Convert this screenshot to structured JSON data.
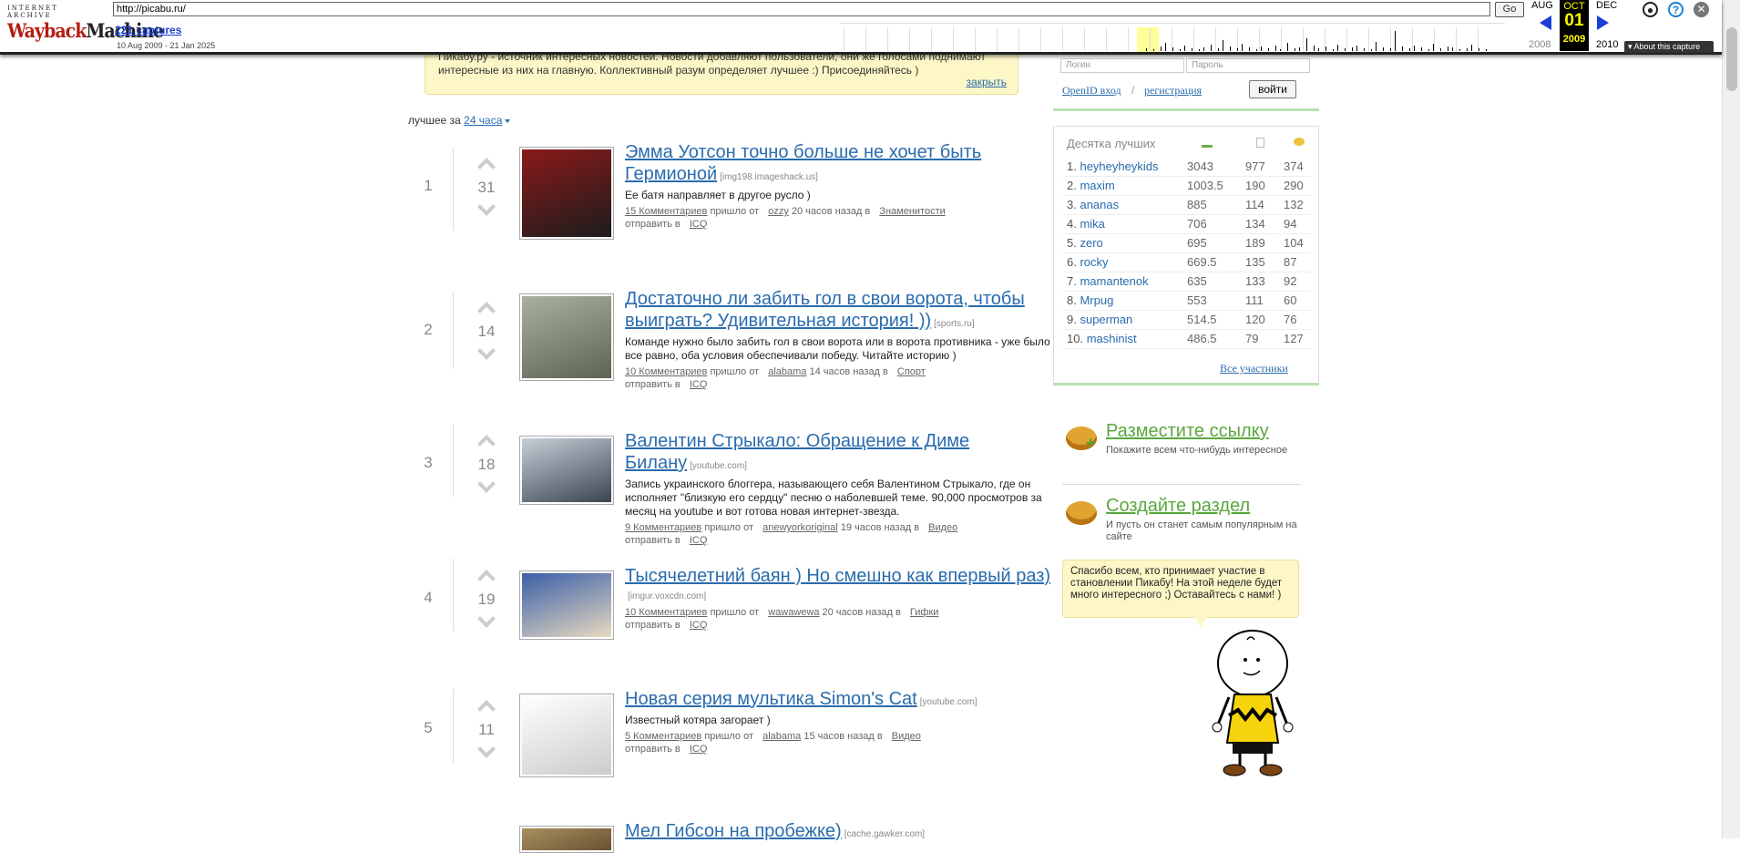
{
  "wayback": {
    "logo_small": "INTERNET ARCHIVE",
    "logo_main_a": "Wayback",
    "logo_main_b": "Machine",
    "url": "http://picabu.ru/",
    "go": "Go",
    "captures": "221 captures",
    "range": "10 Aug 2009 - 21 Jan 2025",
    "prev_month": "AUG",
    "cur_month": "OCT",
    "cur_day": "01",
    "cur_year": "2009",
    "next_month": "DEC",
    "prev_year": "2008",
    "next_year": "2010",
    "about": "About this capture",
    "accent": "#1a3fd6"
  },
  "notice": {
    "text": "Пикабу.ру - источник интересных новостей. Новости добавляют пользователи, они же голосами поднимают интересные из них на главную. Коллективный разум определяет лучшее :) Присоединяйтесь )",
    "close": "закрыть"
  },
  "best": {
    "prefix": "лучшее за",
    "period": "24 часа"
  },
  "posts": [
    {
      "rank": "1",
      "score": "31",
      "title": "Эмма Уотсон точно больше не хочет быть Гермионой",
      "source": "[img198.imageshack.us]",
      "desc": "Ее батя направляет в другое русло )",
      "comments": "15 Комментариев",
      "came_from": "пришло от",
      "user": "ozzy",
      "time": "20 часов назад в",
      "category": "Знаменитости",
      "send_to": "отправить в",
      "icq": "ICQ"
    },
    {
      "rank": "2",
      "score": "14",
      "title": "Достаточно ли забить гол в свои ворота, чтобы выиграть? Удивительная история! ))",
      "source": "[sports.ru]",
      "desc": "Команде нужно было забить гол в свои ворота или в ворота противника - уже было все равно, оба условия обеспечивали победу. Читайте историю )",
      "comments": "10 Комментариев",
      "came_from": "пришло от",
      "user": "alabama",
      "time": "14 часов назад в",
      "category": "Спорт",
      "send_to": "отправить в",
      "icq": "ICQ"
    },
    {
      "rank": "3",
      "score": "18",
      "title": "Валентин Стрыкало: Обращение к Диме Билану",
      "source": "[youtube.com]",
      "desc": "Запись украинского блоггера, называющего себя Валентином Стрыкало, где он исполняет \"близкую его сердцу\" песню о наболевшей теме. 90,000 просмотров за месяц на youtube и вот готова новая интернет-звезда.",
      "comments": "9 Комментариев",
      "came_from": "пришло от",
      "user": "anewyorkoriginal",
      "time": "19 часов назад в",
      "category": "Видео",
      "send_to": "отправить в",
      "icq": "ICQ"
    },
    {
      "rank": "4",
      "score": "19",
      "title": "Тысячелетний баян ) Но смешно как впервый раз)",
      "source": "[imgur.voxcdn.com]",
      "desc": "",
      "comments": "10 Комментариев",
      "came_from": "пришло от",
      "user": "wawawewa",
      "time": "20 часов назад в",
      "category": "Гифки",
      "send_to": "отправить в",
      "icq": "ICQ"
    },
    {
      "rank": "5",
      "score": "11",
      "title": "Новая серия мультика Simon's Cat",
      "source": "[youtube.com]",
      "desc": "Известный котяра загорает )",
      "comments": "5 Комментариев",
      "came_from": "пришло от",
      "user": "alabama",
      "time": "15 часов назад в",
      "category": "Видео",
      "send_to": "отправить в",
      "icq": "ICQ"
    },
    {
      "rank": "",
      "score": "",
      "title": "Мел Гибсон на пробежке)",
      "source": "[cache.gawker.com]",
      "desc": "",
      "comments": "",
      "came_from": "",
      "user": "",
      "time": "",
      "category": "",
      "send_to": "",
      "icq": ""
    }
  ],
  "login": {
    "login_ph": "Логин",
    "pass_ph": "Пароль",
    "openid": "OpenID вход",
    "sep": "/",
    "register": "регистрация",
    "enter": "войти"
  },
  "top10": {
    "title": "Десятка лучших",
    "rows": [
      {
        "n": "1.",
        "name": "heyheyheykids",
        "a": "3043",
        "b": "977",
        "c": "374"
      },
      {
        "n": "2.",
        "name": "maxim",
        "a": "1003.5",
        "b": "190",
        "c": "290"
      },
      {
        "n": "3.",
        "name": "ananas",
        "a": "885",
        "b": "114",
        "c": "132"
      },
      {
        "n": "4.",
        "name": "mika",
        "a": "706",
        "b": "134",
        "c": "94"
      },
      {
        "n": "5.",
        "name": "zero",
        "a": "695",
        "b": "189",
        "c": "104"
      },
      {
        "n": "6.",
        "name": "rocky",
        "a": "669.5",
        "b": "135",
        "c": "87"
      },
      {
        "n": "7.",
        "name": "mamantenok",
        "a": "635",
        "b": "133",
        "c": "92"
      },
      {
        "n": "8.",
        "name": "Mrpug",
        "a": "553",
        "b": "111",
        "c": "60"
      },
      {
        "n": "9.",
        "name": "superman",
        "a": "514.5",
        "b": "120",
        "c": "76"
      },
      {
        "n": "10.",
        "name": "mashinist",
        "a": "486.5",
        "b": "79",
        "c": "127"
      }
    ],
    "all": "Все участники"
  },
  "promos": [
    {
      "title": "Разместите ссылку",
      "desc": "Покажите всем что-нибудь интересное"
    },
    {
      "title": "Создайте раздел",
      "desc": "И пусть он станет самым популярным на сайте"
    }
  ],
  "bubble": "Спасибо всем, кто принимает участие в становлении Пикабу! На этой неделе будет много интересного ;) Оставайтесь с нами! )"
}
